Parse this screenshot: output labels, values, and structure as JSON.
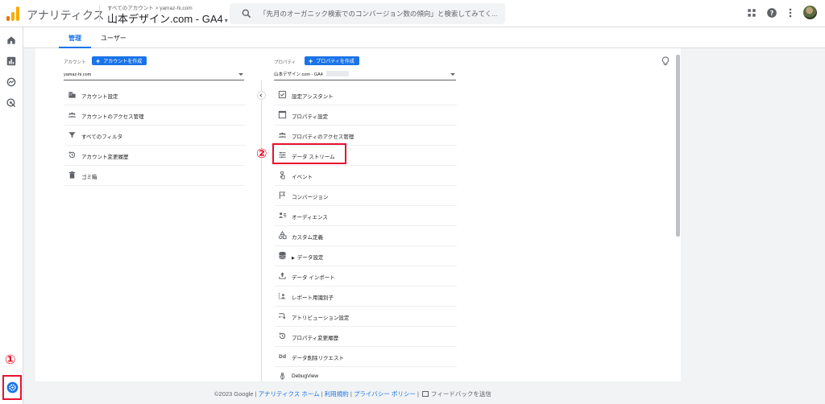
{
  "header": {
    "app_title": "アナリティクス",
    "breadcrumb": "すべてのアカウント > yamaz-hi.com",
    "property_name": "山本デザイン.com - GA4",
    "property_caret": "▾",
    "search_placeholder": "「先月のオーガニック検索でのコンバージョン数の傾向」と検索してみてく..."
  },
  "tabs": [
    {
      "label": "管理",
      "active": true
    },
    {
      "label": "ユーザー",
      "active": false
    }
  ],
  "account_column": {
    "label": "アカウント",
    "create_button": "アカウントを作成",
    "selected": "yamaz-hi.com",
    "items": [
      {
        "label": "アカウント設定",
        "icon": "building-icon"
      },
      {
        "label": "アカウントのアクセス管理",
        "icon": "people-icon"
      },
      {
        "label": "すべてのフィルタ",
        "icon": "filter-icon"
      },
      {
        "label": "アカウント変更履歴",
        "icon": "history-icon"
      },
      {
        "label": "ゴミ箱",
        "icon": "trash-icon"
      }
    ]
  },
  "property_column": {
    "label": "プロパティ",
    "create_button": "プロパティを作成",
    "selected": "山本デザイン.com - GA4",
    "items": [
      {
        "label": "設定アシスタント",
        "icon": "checkbox-icon"
      },
      {
        "label": "プロパティ設定",
        "icon": "window-icon"
      },
      {
        "label": "プロパティのアクセス管理",
        "icon": "people-icon"
      },
      {
        "label": "データ ストリーム",
        "icon": "streams-icon"
      },
      {
        "label": "イベント",
        "icon": "touch-icon"
      },
      {
        "label": "コンバージョン",
        "icon": "flag-icon"
      },
      {
        "label": "オーディエンス",
        "icon": "audience-icon"
      },
      {
        "label": "カスタム定義",
        "icon": "shapes-icon"
      },
      {
        "label": "データ設定",
        "icon": "database-icon"
      },
      {
        "label": "データ インポート",
        "icon": "upload-icon"
      },
      {
        "label": "レポート用識別子",
        "icon": "identity-icon"
      },
      {
        "label": "アトリビューション設定",
        "icon": "attribution-icon"
      },
      {
        "label": "プロパティ変更履歴",
        "icon": "history-icon"
      },
      {
        "label": "データ削除リクエスト",
        "icon": "dd-icon"
      },
      {
        "label": "DebugView",
        "icon": "debug-icon"
      }
    ]
  },
  "markers": {
    "settings": "①",
    "streams": "②"
  },
  "footer": {
    "copyright": "©2023 Google |",
    "link_home": "アナリティクス ホーム",
    "sep1": "|",
    "link_terms": "利用規約",
    "sep2": "|",
    "link_privacy": "プライバシー ポリシー",
    "sep3": "|",
    "feedback": "フィードバックを送信"
  },
  "colors": {
    "accent": "#1a73e8",
    "annotation_red": "#e8112d",
    "logo_orange": "#f9ab00",
    "logo_dark": "#e37400"
  }
}
